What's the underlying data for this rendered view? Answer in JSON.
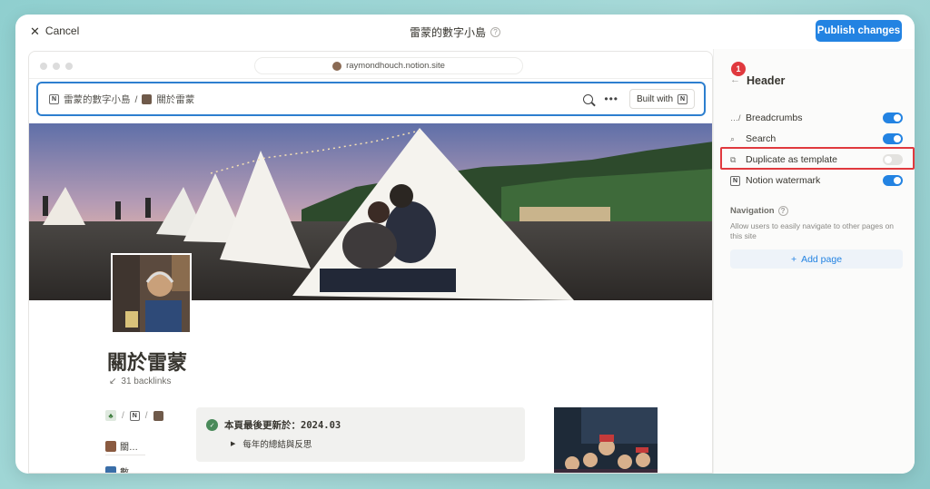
{
  "topbar": {
    "cancel_label": "Cancel",
    "title": "雷蒙的數字小島",
    "publish_label": "Publish changes"
  },
  "preview": {
    "url": "raymondhouch.notion.site",
    "breadcrumb_root": "雷蒙的數字小島",
    "breadcrumb_sep": "/",
    "breadcrumb_page": "關於雷蒙",
    "built_with_label": "Built with",
    "page_title": "關於雷蒙",
    "backlinks": "31 backlinks",
    "mini_crumb_sep": "/",
    "side_items": [
      "關…",
      "數…"
    ],
    "callout_title": "本頁最後更新於：2024.03",
    "callout_toggle": "每年的總結與反思"
  },
  "panel": {
    "step_badge": "1",
    "title": "Header",
    "settings": [
      {
        "label": "Breadcrumbs",
        "icon": "…/",
        "enabled": true
      },
      {
        "label": "Search",
        "icon": "search-icon",
        "enabled": true
      },
      {
        "label": "Duplicate as template",
        "icon": "duplicate-icon",
        "enabled": false
      },
      {
        "label": "Notion watermark",
        "icon": "notion-logo-icon",
        "enabled": true
      }
    ],
    "navigation_title": "Navigation",
    "navigation_desc": "Allow users to easily navigate to other pages on this site",
    "add_page_label": "Add page"
  },
  "colors": {
    "accent": "#2383e2",
    "highlight": "#e0393e",
    "header_outline": "#2d7fcf"
  }
}
